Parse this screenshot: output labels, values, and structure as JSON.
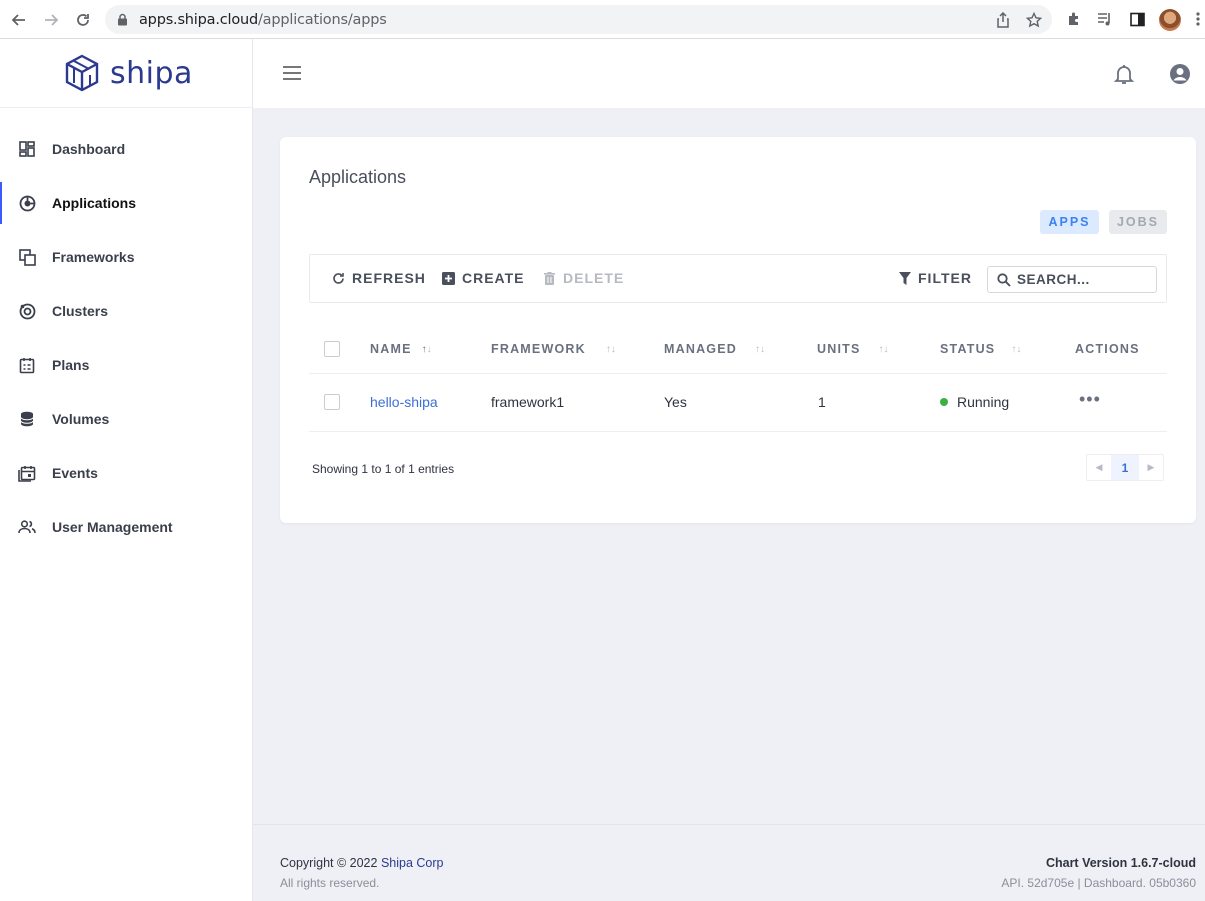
{
  "browser": {
    "url_host": "apps.shipa.cloud",
    "url_path": "/applications/apps"
  },
  "brand": {
    "name": "shipa",
    "color": "#2b3a8f"
  },
  "sidebar": {
    "items": [
      {
        "label": "Dashboard",
        "icon": "dashboard-icon"
      },
      {
        "label": "Applications",
        "icon": "applications-icon",
        "active": true
      },
      {
        "label": "Frameworks",
        "icon": "frameworks-icon"
      },
      {
        "label": "Clusters",
        "icon": "clusters-icon"
      },
      {
        "label": "Plans",
        "icon": "plans-icon"
      },
      {
        "label": "Volumes",
        "icon": "volumes-icon"
      },
      {
        "label": "Events",
        "icon": "events-icon"
      },
      {
        "label": "User Management",
        "icon": "users-icon"
      }
    ]
  },
  "page": {
    "title": "Applications",
    "tabs": {
      "apps": "APPS",
      "jobs": "JOBS"
    }
  },
  "toolbar": {
    "refresh": "REFRESH",
    "create": "CREATE",
    "delete": "DELETE",
    "filter": "FILTER",
    "search_placeholder": "SEARCH..."
  },
  "table": {
    "headers": {
      "name": "NAME",
      "framework": "FRAMEWORK",
      "managed": "MANAGED",
      "units": "UNITS",
      "status": "STATUS",
      "actions": "ACTIONS"
    },
    "rows": [
      {
        "name": "hello-shipa",
        "framework": "framework1",
        "managed": "Yes",
        "units": "1",
        "status": "Running"
      }
    ],
    "entries_text": "Showing 1 to 1 of 1 entries",
    "current_page": "1"
  },
  "footer": {
    "copyright_prefix": "Copyright © 2022",
    "company": "Shipa Corp",
    "rights": "All rights reserved.",
    "chart_version": "Chart Version 1.6.7-cloud",
    "api_version": "API. 52d705e | Dashboard. 05b0360"
  },
  "colors": {
    "accent": "#3d5afe",
    "status_running": "#3cb043",
    "link": "#3b6fd6"
  }
}
